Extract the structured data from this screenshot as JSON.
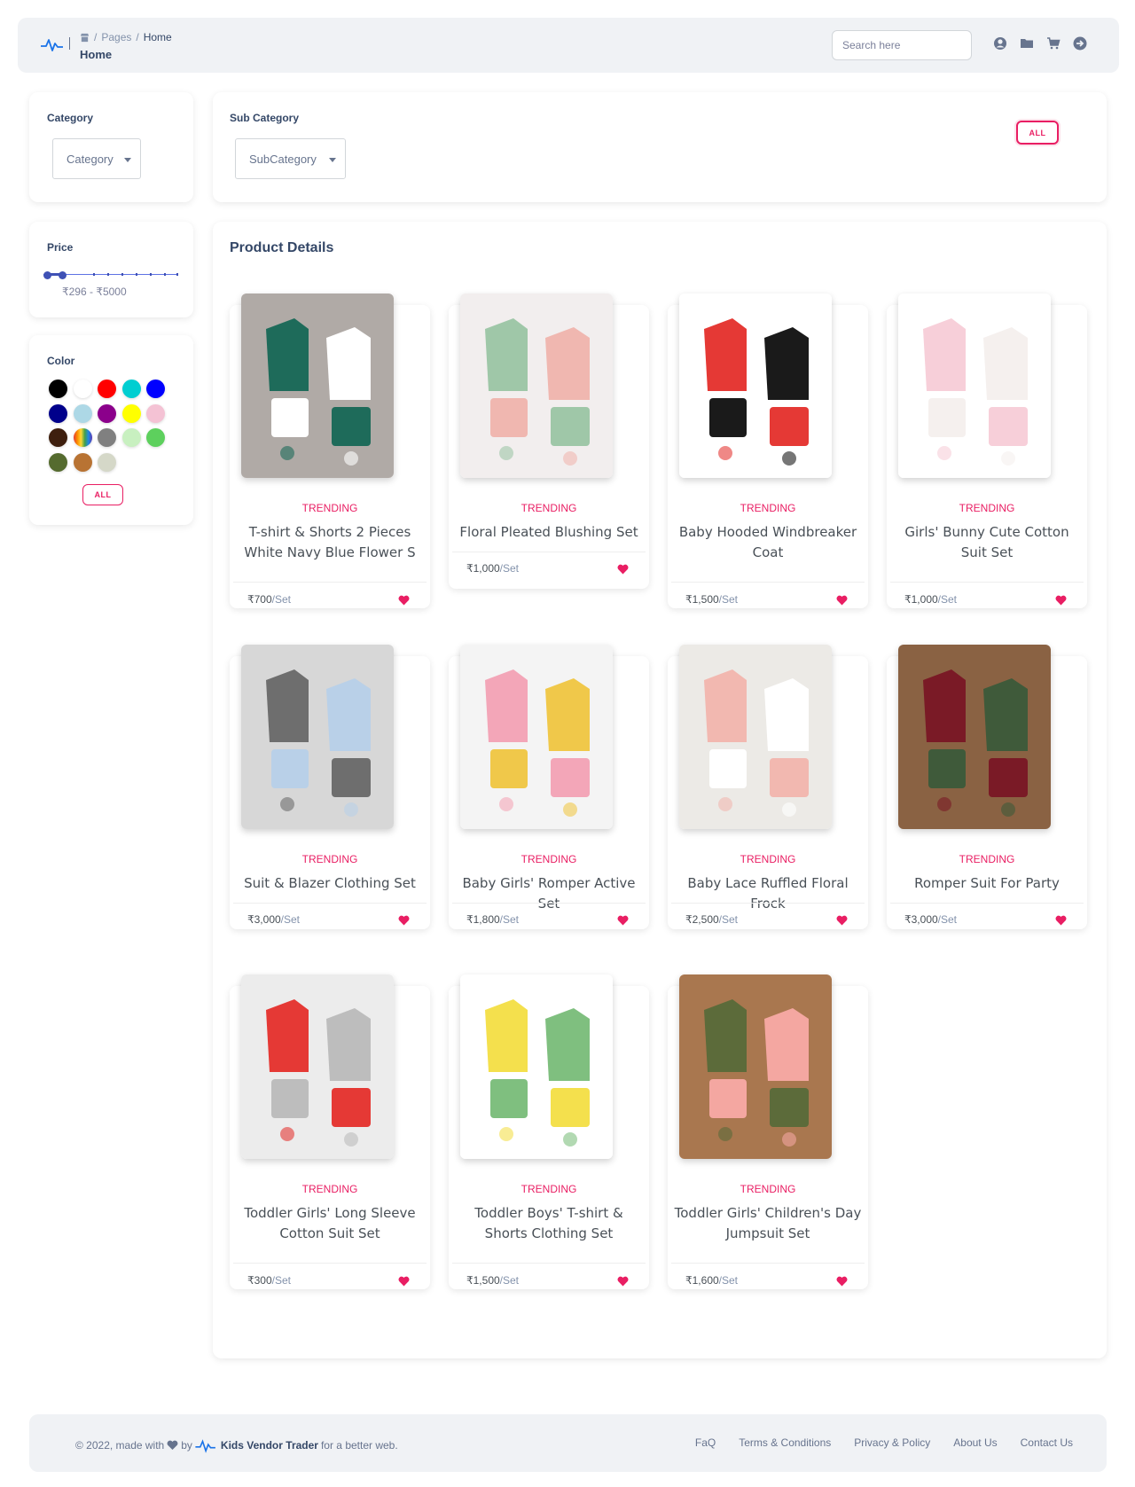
{
  "header": {
    "breadcrumb": [
      "Pages",
      "Home"
    ],
    "title": "Home",
    "search_placeholder": "Search here",
    "icons": [
      "user-circle-icon",
      "folder-icon",
      "cart-icon",
      "arrow-right-circle-icon"
    ]
  },
  "filters": {
    "category": {
      "label": "Category",
      "value": "Category"
    },
    "subcategory": {
      "label": "Sub Category",
      "value": "SubCategory"
    },
    "all_label": "ALL",
    "price": {
      "label": "Price",
      "range_text": "₹296 - ₹5000",
      "min": 296,
      "max": 5000
    },
    "color": {
      "label": "Color",
      "all_label": "ALL",
      "swatches": [
        "#000000",
        "#ffffff",
        "#ff0000",
        "#00ced1",
        "#0000ff",
        "#00008b",
        "#add8e6",
        "#8b008b",
        "#ffff00",
        "#f4c2d4",
        "#3e1f0e",
        "multicolor",
        "#808080",
        "#c8f0c0",
        "#5dd05d",
        "#556b2f",
        "#b87333",
        "#d5d8c8"
      ]
    }
  },
  "products_section": {
    "title": "Product Details",
    "items": [
      {
        "badge": "TRENDING",
        "name": "T-shirt & Shorts 2 Pieces White Navy Blue Flower S",
        "price": "₹700",
        "unit": "/Set"
      },
      {
        "badge": "TRENDING",
        "name": "Floral Pleated Blushing Set",
        "price": "₹1,000",
        "unit": "/Set"
      },
      {
        "badge": "TRENDING",
        "name": "Baby Hooded Windbreaker Coat",
        "price": "₹1,500",
        "unit": "/Set"
      },
      {
        "badge": "TRENDING",
        "name": "Girls' Bunny Cute Cotton Suit Set",
        "price": "₹1,000",
        "unit": "/Set"
      },
      {
        "badge": "TRENDING",
        "name": "Suit & Blazer Clothing Set",
        "price": "₹3,000",
        "unit": "/Set"
      },
      {
        "badge": "TRENDING",
        "name": "Baby Girls' Romper Active Set",
        "price": "₹1,800",
        "unit": "/Set"
      },
      {
        "badge": "TRENDING",
        "name": "Baby Lace Ruffled Floral Frock",
        "price": "₹2,500",
        "unit": "/Set"
      },
      {
        "badge": "TRENDING",
        "name": "Romper Suit For Party",
        "price": "₹3,000",
        "unit": "/Set"
      },
      {
        "badge": "TRENDING",
        "name": "Toddler Girls' Long Sleeve Cotton Suit Set",
        "price": "₹300",
        "unit": "/Set"
      },
      {
        "badge": "TRENDING",
        "name": "Toddler Boys' T-shirt & Shorts Clothing Set",
        "price": "₹1,500",
        "unit": "/Set"
      },
      {
        "badge": "TRENDING",
        "name": "Toddler Girls' Children's Day Jumpsuit Set",
        "price": "₹1,600",
        "unit": "/Set"
      }
    ]
  },
  "footer": {
    "copyright_prefix": "© 2022, made with",
    "copyright_by": "by",
    "brand": "Kids Vendor Trader",
    "copyright_suffix": "for a better web.",
    "links": [
      "FaQ",
      "Terms & Conditions",
      "Privacy & Policy",
      "About Us",
      "Contact Us"
    ]
  },
  "colors": {
    "accent": "#e91e63",
    "primary": "#344767",
    "slider": "#3f51b5"
  }
}
